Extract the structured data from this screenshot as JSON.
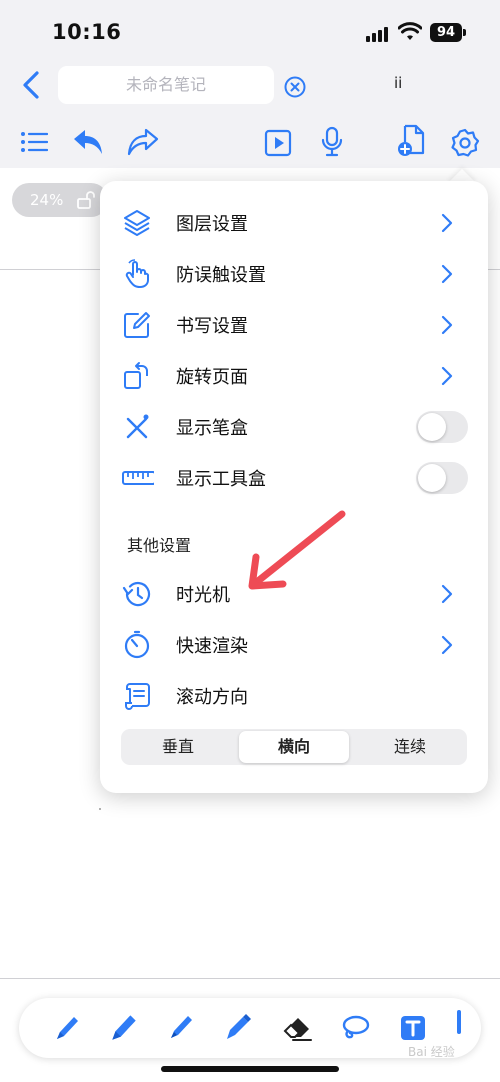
{
  "status_bar": {
    "time": "10:16",
    "battery": "94"
  },
  "header": {
    "title_placeholder": "未命名笔记",
    "right_label": "ii"
  },
  "canvas": {
    "zoom_label": "24%"
  },
  "settings_menu": {
    "items": [
      {
        "label": "图层设置",
        "control": "chevron",
        "icon": "layers-icon"
      },
      {
        "label": "防误触设置",
        "control": "chevron",
        "icon": "hand-pointer-icon"
      },
      {
        "label": "书写设置",
        "control": "chevron",
        "icon": "edit-square-icon"
      },
      {
        "label": "旋转页面",
        "control": "chevron",
        "icon": "rotate-page-icon"
      },
      {
        "label": "显示笔盒",
        "control": "toggle",
        "toggle_on": false,
        "icon": "pen-cross-icon"
      },
      {
        "label": "显示工具盒",
        "control": "toggle",
        "toggle_on": false,
        "icon": "ruler-icon"
      }
    ],
    "section_title": "其他设置",
    "other_items": [
      {
        "label": "时光机",
        "control": "chevron",
        "icon": "history-clock-icon"
      },
      {
        "label": "快速渲染",
        "control": "chevron",
        "icon": "timer-icon"
      },
      {
        "label": "滚动方向",
        "control": "none",
        "icon": "scroll-icon"
      }
    ],
    "scroll_direction": {
      "options": [
        "垂直",
        "横向",
        "连续"
      ],
      "selected": "横向"
    }
  },
  "watermark": "Bai 经验",
  "colors": {
    "accent": "#2f7cf6",
    "annotation_arrow": "#ee4b55"
  }
}
